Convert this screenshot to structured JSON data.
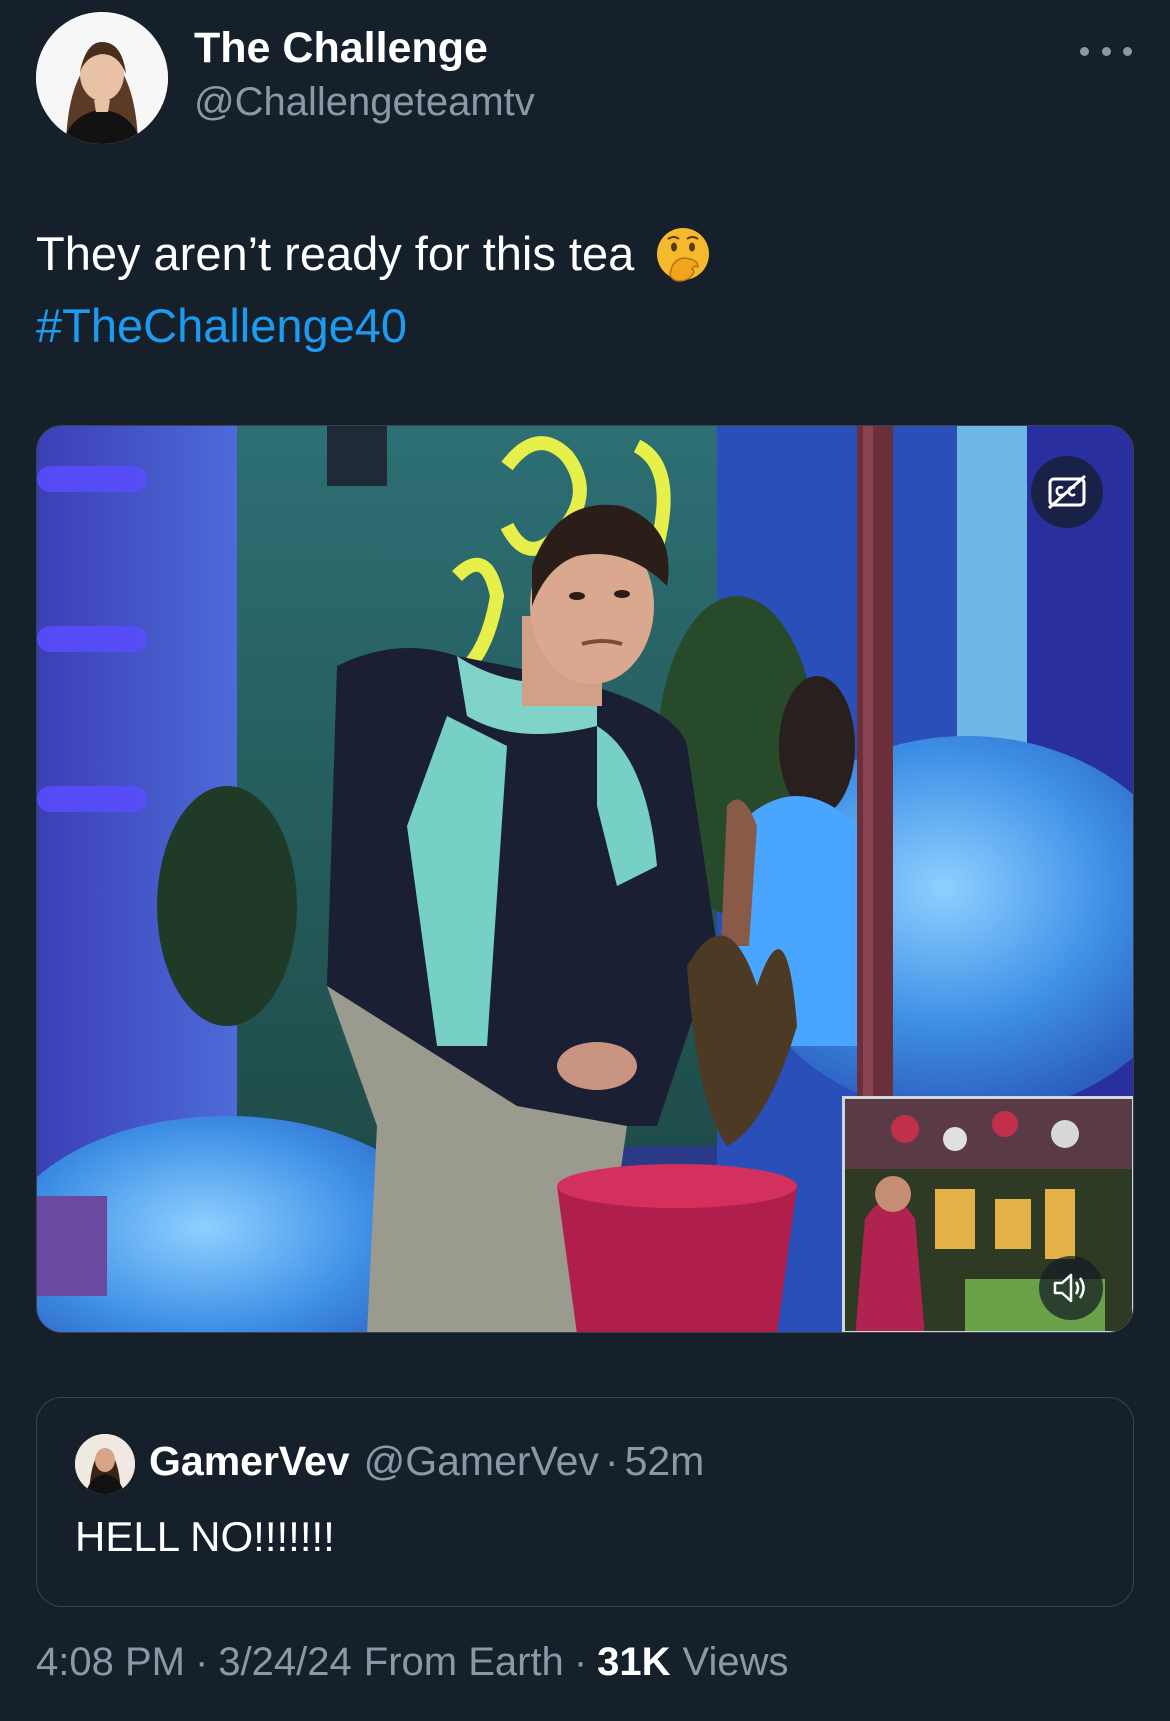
{
  "tweet": {
    "author": {
      "name": "The Challenge",
      "handle": "@Challengeteamtv"
    },
    "text": "They aren’t ready for this tea",
    "emoji": "face-with-hand-over-mouth-emoji",
    "hashtag": "#TheChallenge40",
    "media": {
      "type": "video",
      "captions_icon": "closed-captions-icon",
      "sound_icon": "speaker-icon"
    },
    "quoted": {
      "name": "GamerVev",
      "handle": "@GamerVev",
      "separator": "·",
      "time": "52m",
      "text": "HELL NO!!!!!!!"
    },
    "meta": {
      "time": "4:08 PM",
      "sep1": "·",
      "date": "3/24/24",
      "location": "From Earth",
      "sep2": "·",
      "views_count": "31K",
      "views_label": "Views"
    }
  },
  "colors": {
    "background": "#15202b",
    "link": "#1d9bf0",
    "secondary_text": "#8b98a5",
    "border": "#38444d"
  }
}
